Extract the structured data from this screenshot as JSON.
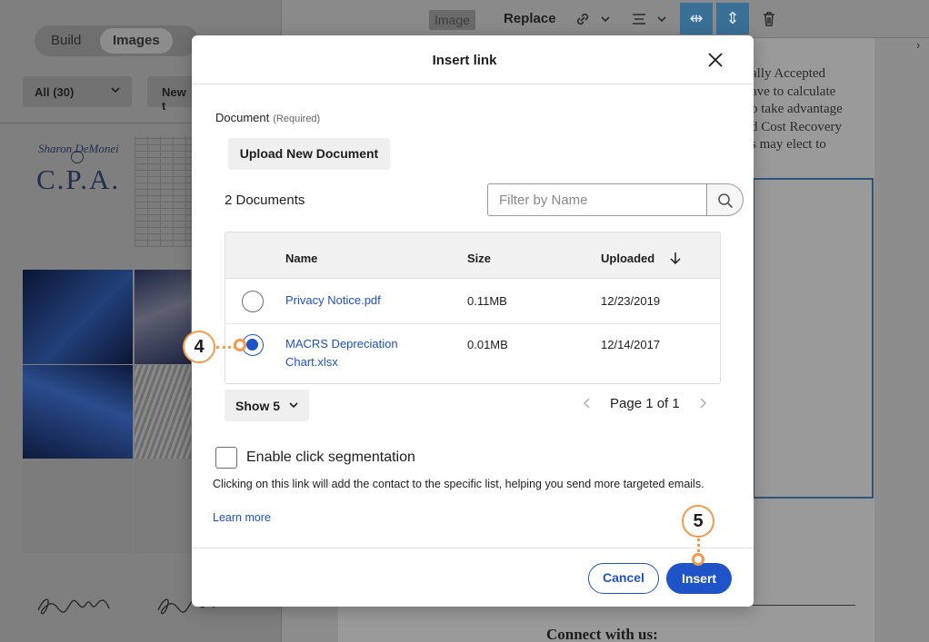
{
  "background": {
    "tabs": {
      "build": "Build",
      "images": "Images"
    },
    "filter_all": "All (30)",
    "new_label": "New t",
    "logo": {
      "subtitle": "Sharon DeMonei",
      "main": "C.P.A."
    },
    "toolbar": {
      "image_tag": "Image",
      "replace": "Replace"
    },
    "doc_text_lines": [
      "ally Accepted",
      "ave to calculate",
      "o take advantage",
      "d Cost Recovery",
      "s may elect to"
    ],
    "connect_heading": "Connect with us:"
  },
  "modal": {
    "title": "Insert link",
    "document_label": "Document",
    "required_label": "(Required)",
    "upload_button": "Upload New Document",
    "documents_count": "2 Documents",
    "filter_placeholder": "Filter by Name",
    "columns": {
      "name": "Name",
      "size": "Size",
      "uploaded": "Uploaded"
    },
    "rows": [
      {
        "name": "Privacy Notice.pdf",
        "size": "0.11MB",
        "uploaded": "12/23/2019",
        "selected": false
      },
      {
        "name": "MACRS Depreciation Chart.xlsx",
        "size": "0.01MB",
        "uploaded": "12/14/2017",
        "selected": true
      }
    ],
    "show_label": "Show 5",
    "pager_text": "Page 1 of 1",
    "segmentation_label": "Enable click segmentation",
    "segmentation_checked": false,
    "help_text": "Clicking on this link will add the contact to the specific list, helping you send more targeted emails.",
    "learn_more": "Learn more",
    "cancel": "Cancel",
    "insert": "Insert"
  },
  "callouts": {
    "step_a": "4",
    "step_b": "5"
  },
  "colors": {
    "accent": "#1f53c8",
    "link": "#1c50c9",
    "callout": "#f29a4a"
  }
}
